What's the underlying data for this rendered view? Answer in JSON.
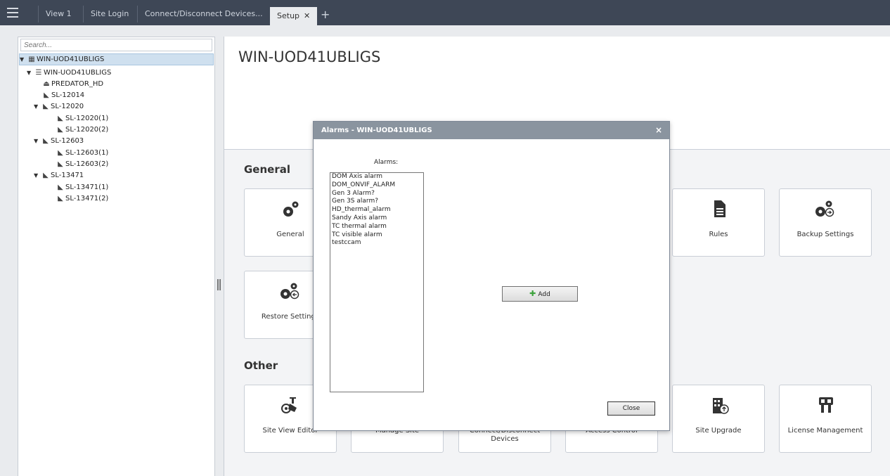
{
  "tabs": [
    {
      "label": "View 1"
    },
    {
      "label": "Site Login"
    },
    {
      "label": "Connect/Disconnect Devices..."
    },
    {
      "label": "Setup",
      "close": "✕"
    }
  ],
  "new_tab": "+",
  "search": {
    "placeholder": "Search..."
  },
  "tree": [
    {
      "label": "WIN-UOD41UBLIGS"
    },
    {
      "label": "WIN-UOD41UBLIGS"
    },
    {
      "label": "PREDATOR_HD"
    },
    {
      "label": "SL-12014"
    },
    {
      "label": "SL-12020"
    },
    {
      "label": "SL-12020(1)"
    },
    {
      "label": "SL-12020(2)"
    },
    {
      "label": "SL-12603"
    },
    {
      "label": "SL-12603(1)"
    },
    {
      "label": "SL-12603(2)"
    },
    {
      "label": "SL-13471"
    },
    {
      "label": "SL-13471(1)"
    },
    {
      "label": "SL-13471(2)"
    }
  ],
  "main": {
    "title": "WIN-UOD41UBLIGS",
    "general_title": "General",
    "other_title": "Other",
    "general_cards": [
      {
        "label": "General",
        "icon": "gear-icon"
      },
      {
        "label": "Rules",
        "icon": "document-icon"
      },
      {
        "label": "Backup Settings",
        "icon": "gears-backup-icon"
      },
      {
        "label": "Restore Settings",
        "icon": "gears-restore-icon"
      }
    ],
    "other_cards": [
      {
        "label": "Site View Editor",
        "icon": "camera-icon"
      },
      {
        "label": "Manage Site",
        "icon": "manage-icon"
      },
      {
        "label": "Connect/Disconnect Devices",
        "icon": "connect-icon"
      },
      {
        "label": "Access Control",
        "icon": "lock-icon"
      },
      {
        "label": "Site Upgrade",
        "icon": "building-upgrade-icon"
      },
      {
        "label": "License Management",
        "icon": "key-icon"
      }
    ]
  },
  "dialog": {
    "title": "Alarms - WIN-UOD41UBLIGS",
    "close_x": "×",
    "alarms_label": "Alarms:",
    "alarms": [
      "DOM Axis alarm",
      "DOM_ONVIF_ALARM",
      "Gen 3 Alarm?",
      "Gen 3S alarm?",
      "HD_thermal_alarm",
      "Sandy Axis alarm",
      "TC thermal alarm",
      "TC visible alarm",
      "testccam"
    ],
    "add_label": "Add",
    "close_label": "Close"
  },
  "colors": {
    "topbar": "#3e4756",
    "dialog_title": "#8a949f",
    "selection": "#cfe0ef"
  }
}
